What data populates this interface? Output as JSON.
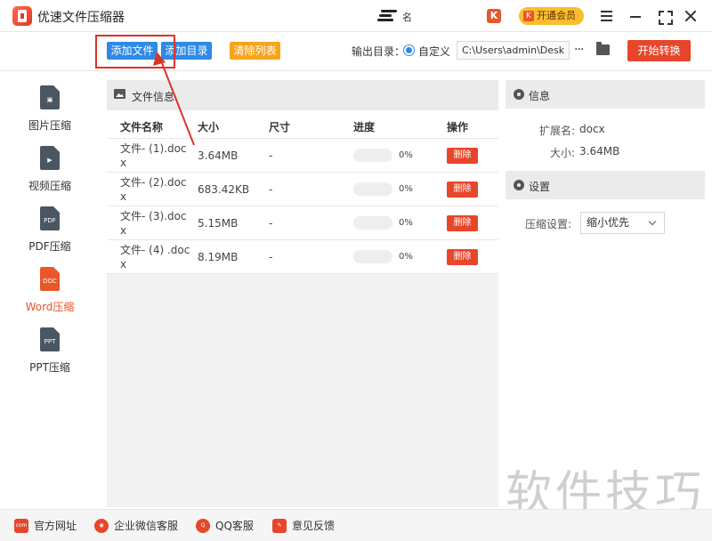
{
  "app": {
    "title": "优速文件压缩器",
    "center_text": "名",
    "vip_label": "开通会员",
    "vip_k": "K"
  },
  "toolbar": {
    "add_file": "添加文件",
    "add_dir": "添加目录",
    "clear_list": "清除列表",
    "output_label": "输出目录：",
    "custom_label": "自定义",
    "output_path": "C:\\Users\\admin\\Desktop",
    "more": "···",
    "start": "开始转换"
  },
  "sidebar": {
    "items": [
      {
        "label": "图片压缩",
        "glyph": "▣",
        "icon": "image-file-icon",
        "active": false
      },
      {
        "label": "视频压缩",
        "glyph": "▶",
        "icon": "video-file-icon",
        "active": false
      },
      {
        "label": "PDF压缩",
        "glyph": "PDF",
        "icon": "pdf-file-icon",
        "active": false
      },
      {
        "label": "Word压缩",
        "glyph": "DOC",
        "icon": "word-file-icon",
        "active": true
      },
      {
        "label": "PPT压缩",
        "glyph": "PPT",
        "icon": "ppt-file-icon",
        "active": false
      }
    ]
  },
  "file_panel": {
    "title": "文件信息",
    "headers": [
      "文件名称",
      "大小",
      "尺寸",
      "进度",
      "操作"
    ],
    "rows": [
      {
        "name": "文件- (1).docx",
        "size": "3.64MB",
        "dim": "-",
        "progress": 0,
        "pct": "0%",
        "action": "删除"
      },
      {
        "name": "文件- (2).docx",
        "size": "683.42KB",
        "dim": "-",
        "progress": 0,
        "pct": "0%",
        "action": "删除"
      },
      {
        "name": "文件- (3).docx",
        "size": "5.15MB",
        "dim": "-",
        "progress": 0,
        "pct": "0%",
        "action": "删除"
      },
      {
        "name": "文件- (4) .docx",
        "size": "8.19MB",
        "dim": "-",
        "progress": 0,
        "pct": "0%",
        "action": "删除"
      }
    ]
  },
  "info_panel": {
    "title": "信息",
    "ext_label": "扩展名:",
    "ext_value": "docx",
    "size_label": "大小:",
    "size_value": "3.64MB"
  },
  "settings_panel": {
    "title": "设置",
    "compress_label": "压缩设置:",
    "compress_value": "缩小优先"
  },
  "watermark": "软件技巧",
  "footer": {
    "items": [
      {
        "label": "官方网址",
        "glyph": "com"
      },
      {
        "label": "企业微信客服",
        "glyph": "◉"
      },
      {
        "label": "QQ客服",
        "glyph": "Q"
      },
      {
        "label": "意见反馈",
        "glyph": "✎"
      }
    ]
  },
  "colors": {
    "accent_blue": "#2d8ae6",
    "accent_red": "#e8462a",
    "accent_orange": "#f7a41b",
    "vip_yellow": "#fbbd2e"
  }
}
